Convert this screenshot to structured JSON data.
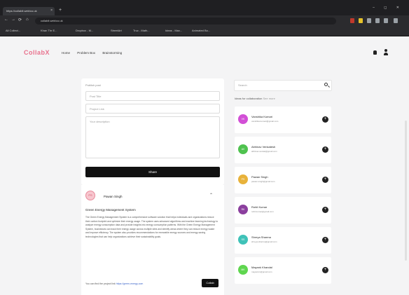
{
  "browser": {
    "tab_title": "https://collabit.web/co.uk",
    "tab_close": "×",
    "new_tab": "+",
    "window_controls": "– ◻ ✕",
    "nav": {
      "back": "←",
      "forward": "→",
      "reload": "⟳",
      "home": "⌂"
    },
    "url": "collabit.web/co.uk",
    "bookmarks": [
      "All Collect...",
      "Khan Thr E...",
      "Dropbox - M...",
      "StreetArt",
      "Truc - Math...",
      "Ideas - Max...",
      "Animated Bo..."
    ]
  },
  "app": {
    "logo": "CollabX",
    "nav": [
      "Home",
      "Problem Box",
      "Brainstorming"
    ],
    "icons": {
      "notifications": "bell-icon",
      "profile": "user-icon"
    }
  },
  "composer": {
    "label": "Publish post",
    "title_placeholder": "Post Title",
    "link_placeholder": "Project Link",
    "description_placeholder": "Your description",
    "share_label": "Share"
  },
  "post": {
    "avatar_initials": "PS",
    "author": "Pawan Singh",
    "title": "Green Energy Management System",
    "description": "The Green Energy Management System is a comprehensive software solution that helps individuals and organizations reduce their carbon footprint and optimize their energy usage. The system uses advanced algorithms and machine learning technology to analyze energy consumption data and provide insights into energy consumption patterns. With the Green Energy Management System, businesses can track their energy usage across multiple sites and identify areas where they can reduce energy waste and improve efficiency. The system also provides recommendations for renewable energy sources and energy-saving technologies that can help organizations achieve their sustainability goals.",
    "link_prefix": "You can find the project link",
    "link_text": "https://green-energy.com",
    "collab_label": "Collab"
  },
  "sidebar": {
    "search_placeholder": "Search",
    "ideas_title": "Ideas for collaboration",
    "ideas_subtitle": "See more",
    "ideas": [
      {
        "name": "Vanshika Kumari",
        "email": "vanshika.kumari@gmail.com",
        "initials": "VK",
        "color": "#d24fd6"
      },
      {
        "name": "Abhinav Venkatesh",
        "email": "abhinav.venkat@gmail.com",
        "initials": "AV",
        "color": "#4fc24f"
      },
      {
        "name": "Pawan Singh",
        "email": "pawan.singh@gmail.com",
        "initials": "PS",
        "color": "#e8b23a"
      },
      {
        "name": "Rohit Kumar",
        "email": "rohit.kumar@gmail.com",
        "initials": "RK",
        "color": "#8b3f9e"
      },
      {
        "name": "Shreya Sharma",
        "email": "shreya.sharma@gmail.com",
        "initials": "SS",
        "color": "#3fc2b8"
      },
      {
        "name": "Mayank Khandal",
        "email": "mayank.k@gmail.com",
        "initials": "MK",
        "color": "#5fd64f"
      }
    ]
  }
}
